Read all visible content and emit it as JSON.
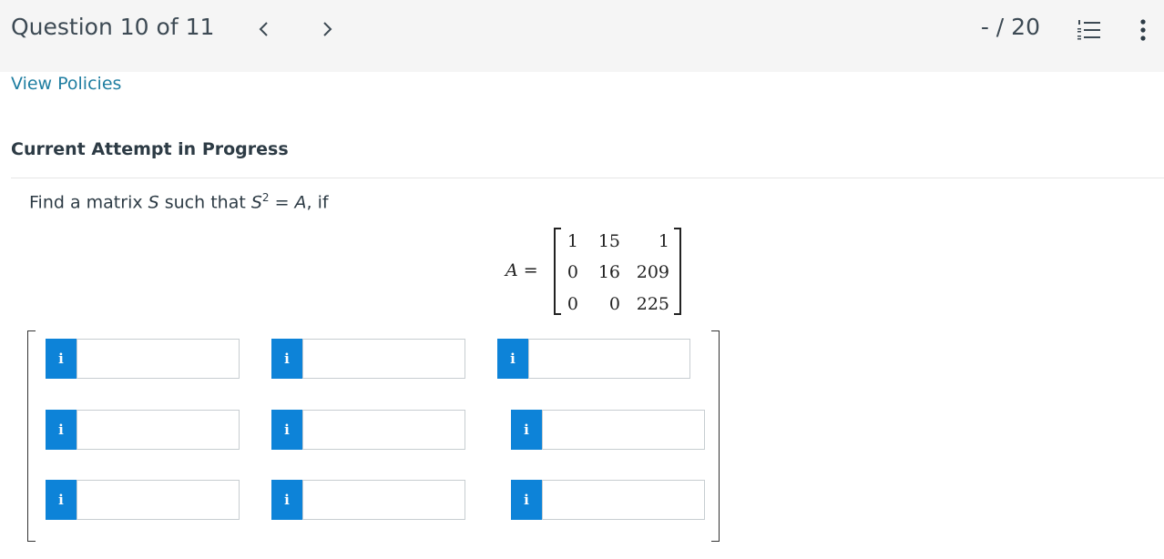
{
  "header": {
    "question_title": "Question 10 of 11",
    "score": "- / 20",
    "prev_icon": "chevron-left-icon",
    "next_icon": "chevron-right-icon",
    "list_icon": "numbered-list-icon",
    "more_icon": "more-vertical-icon"
  },
  "links": {
    "view_policies": "View Policies"
  },
  "status": {
    "attempt": "Current Attempt in Progress"
  },
  "question": {
    "prefix": "Find a matrix ",
    "S": "S",
    "mid": " such that ",
    "S2": "S",
    "exp": "2",
    "eq": " = ",
    "A": "A",
    "suffix": ", if"
  },
  "matrix_a": {
    "label_var": "A",
    "label_eq": " =",
    "rows": [
      [
        "1",
        "15",
        "1"
      ],
      [
        "0",
        "16",
        "209"
      ],
      [
        "0",
        "0",
        "225"
      ]
    ]
  },
  "answer_grid": {
    "info_label": "i",
    "values": [
      [
        "",
        "",
        ""
      ],
      [
        "",
        "",
        ""
      ],
      [
        "",
        "",
        ""
      ]
    ]
  },
  "colors": {
    "link": "#1f7ea1",
    "info_button": "#0d83d8",
    "header_bg": "#f5f5f5"
  }
}
